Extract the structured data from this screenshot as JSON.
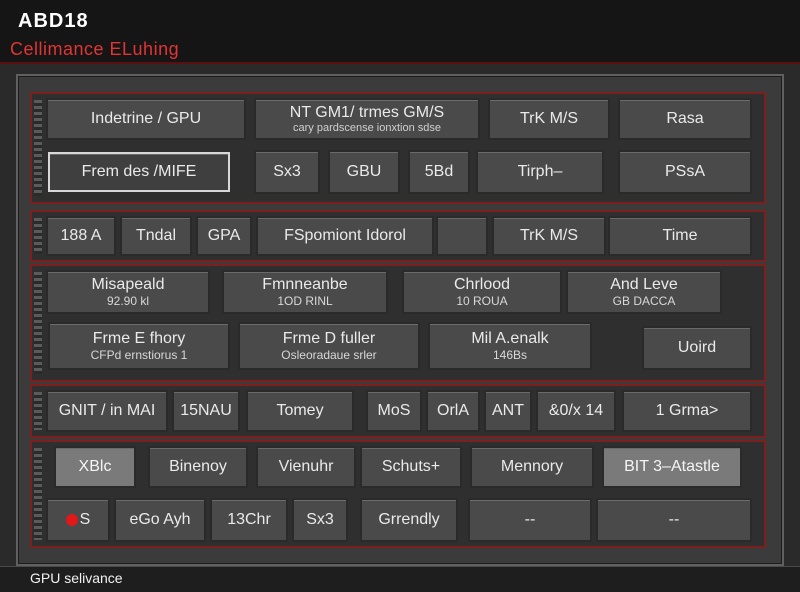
{
  "window": {
    "title": "ABD18",
    "subtitle": "Cellimance  ELuhing"
  },
  "rows": {
    "r1": [
      "Indetrine / GPU",
      "NT GM1/ trmes GM/S",
      "TrK M/S",
      "Rasa"
    ],
    "r1_sub": "cary pardscense ionxtion sdse",
    "r2": [
      "Frem des /MIFE",
      "Sx3",
      "GBU",
      "5Bd",
      "Tirph–",
      "PSsA"
    ],
    "r3": [
      "188 A",
      "Tndal",
      "GPA",
      "FSpomiont Idorol",
      "",
      "TrK M/S",
      "Time"
    ],
    "r4": [
      {
        "label": "Misapeald",
        "sub": "92.90 kl"
      },
      {
        "label": "Fmnneanbe",
        "sub": "1OD RINL"
      },
      {
        "label": "Chrlood",
        "sub": "10 ROUA"
      },
      {
        "label": "And Leve",
        "sub": "GB DACCA"
      }
    ],
    "r5": [
      {
        "label": "Frme E fhory",
        "sub": "CFPd ernstiorus 1"
      },
      {
        "label": "Frme D fuller",
        "sub": "Osleoradaue srler"
      },
      {
        "label": "Mil A.enalk",
        "sub": "146Bs"
      },
      {
        "label": "Uoird",
        "sub": ""
      }
    ],
    "r6": [
      "GNIT / in MAI",
      "15NAU",
      "Tomey",
      "MoS",
      "OrlA",
      "ANT",
      "&0/x 14",
      "1 Grma>"
    ],
    "r7": [
      "XBlc",
      "Binenoy",
      "Vienuhr",
      "Schuts+",
      "Mennory",
      "BIT 3–Atastle"
    ],
    "r8": [
      "S",
      "eGo Ayh",
      "13Chr",
      "Sx3",
      "Grrendly",
      "--",
      "--"
    ]
  },
  "status": {
    "text": "GPU selivance"
  },
  "colors": {
    "accent": "#e23434",
    "section_border": "#7b1f1f",
    "cell_bg": "#4a4a4a"
  }
}
